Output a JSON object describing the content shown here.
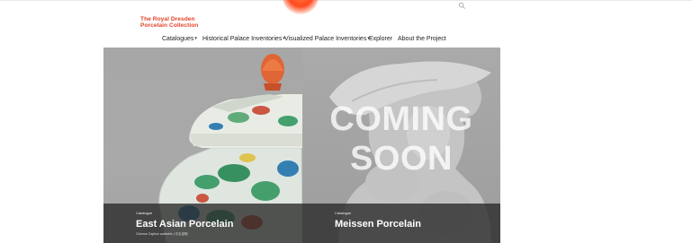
{
  "brand": {
    "line1": "The Royal Dresden",
    "line2": "Porcelain Collection",
    "color": "#e2452a"
  },
  "header": {
    "search_icon": "search-icon"
  },
  "nav": {
    "items": [
      {
        "label": "Catalogues",
        "has_dropdown": true
      },
      {
        "label": "Historical Palace Inventories",
        "has_dropdown": true
      },
      {
        "label": "Visualized Palace Inventories",
        "has_dropdown": true
      },
      {
        "label": "Explorer",
        "has_dropdown": false
      },
      {
        "label": "About the Project",
        "has_dropdown": false
      }
    ],
    "caret": "▾"
  },
  "cards": [
    {
      "kicker": "Catalogue",
      "title": "East Asian Porcelain",
      "subtitle": "Chinese Caption available | 中文说明",
      "image": "porcelain-jar"
    },
    {
      "kicker": "Catalogue",
      "title": "Meissen Porcelain",
      "overlay_line1": "COMING",
      "overlay_line2": "SOON",
      "image": "porcelain-bust"
    }
  ]
}
